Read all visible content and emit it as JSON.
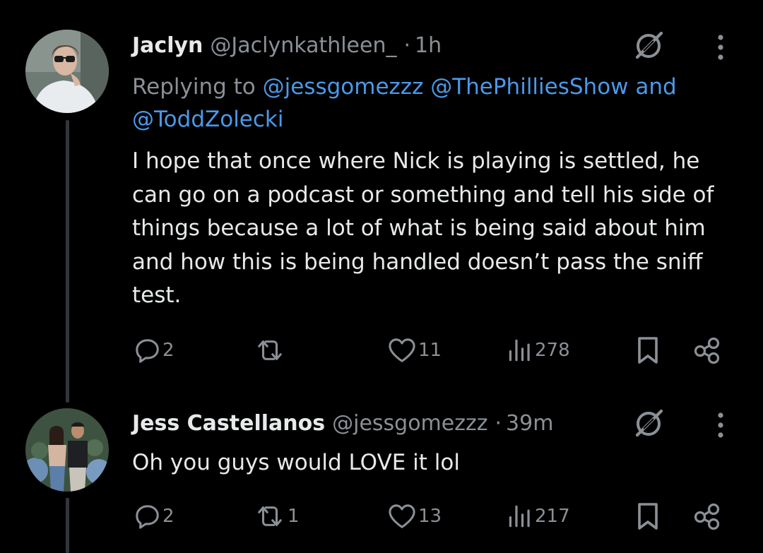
{
  "colors": {
    "background": "#000000",
    "primary_text": "#e7e9ea",
    "secondary_text": "#8b9096",
    "link": "#4a99e9",
    "thread_line": "#333639"
  },
  "tweets": [
    {
      "display_name": "Jaclyn",
      "handle": "@Jaclynkathleen_",
      "separator": "·",
      "timestamp": "1h",
      "replying_prefix": "Replying to ",
      "replying_mentions": [
        "@jessgomezzz",
        "@ThePhilliesShow"
      ],
      "replying_joiner": " and",
      "replying_last": "@ToddZolecki",
      "text_lines": [
        "I hope that once where Nick is playing is settled, he",
        "can go on a podcast or something and tell his side of",
        "things because a lot of what is being said about him",
        "and how this is being handled doesn’t pass the sniff",
        "test."
      ],
      "actions": {
        "replies": "2",
        "reposts": "",
        "likes": "11",
        "views": "278"
      },
      "icons": [
        "reply-icon",
        "repost-icon",
        "like-icon",
        "views-icon",
        "bookmark-icon",
        "share-icon",
        "grok-icon",
        "more-icon"
      ]
    },
    {
      "display_name": "Jess Castellanos",
      "handle": "@jessgomezzz",
      "separator": "·",
      "timestamp": "39m",
      "text_lines": [
        "Oh you guys would LOVE it lol"
      ],
      "actions": {
        "replies": "2",
        "reposts": "1",
        "likes": "13",
        "views": "217"
      },
      "icons": [
        "reply-icon",
        "repost-icon",
        "like-icon",
        "views-icon",
        "bookmark-icon",
        "share-icon",
        "grok-icon",
        "more-icon"
      ]
    }
  ]
}
